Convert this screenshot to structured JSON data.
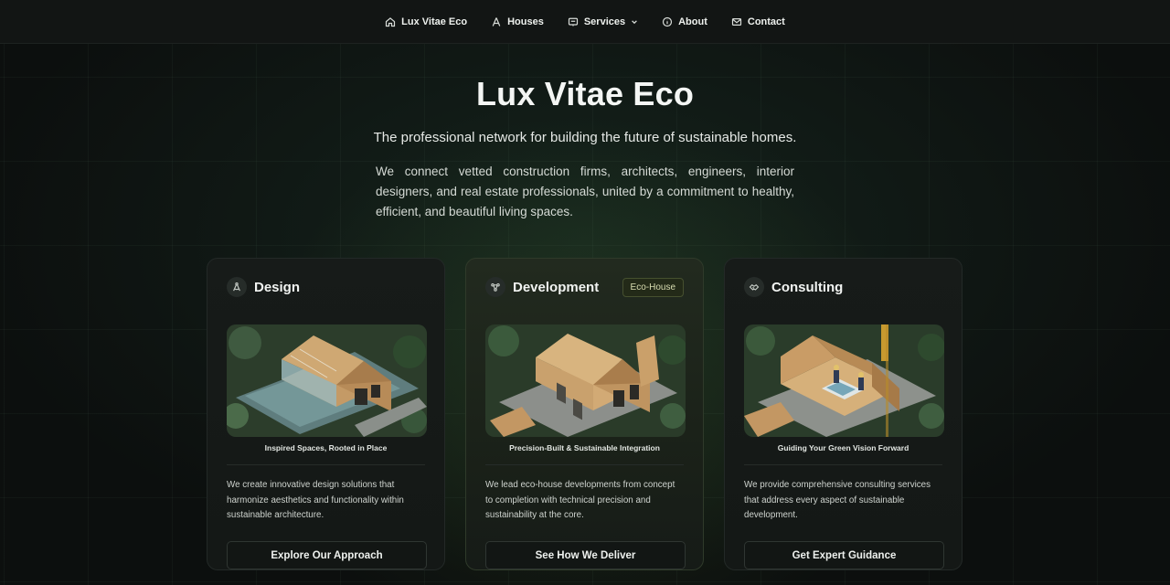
{
  "nav": {
    "items": [
      {
        "label": "Lux Vitae Eco",
        "icon": "home-icon"
      },
      {
        "label": "Houses",
        "icon": "houses-icon"
      },
      {
        "label": "Services",
        "icon": "services-icon",
        "has_dropdown": true
      },
      {
        "label": "About",
        "icon": "info-icon"
      },
      {
        "label": "Contact",
        "icon": "mail-icon"
      }
    ]
  },
  "hero": {
    "title": "Lux Vitae Eco",
    "tagline": "The professional network for building the future of sustainable homes.",
    "intro": "We connect vetted construction firms, architects, engineers, interior designers, and real estate professionals, united by a commitment to healthy, efficient, and beautiful living spaces."
  },
  "cards": [
    {
      "title": "Design",
      "icon": "compass-icon",
      "caption": "Inspired Spaces, Rooted in Place",
      "description": "We create innovative design solutions that harmonize aesthetics and functionality within sustainable architecture.",
      "cta": "Explore Our Approach"
    },
    {
      "title": "Development",
      "icon": "network-icon",
      "badge": "Eco-House",
      "caption": "Precision-Built & Sustainable Integration",
      "description": "We lead eco-house developments from concept to completion with technical precision and sustainability at the core.",
      "cta": "See How We Deliver"
    },
    {
      "title": "Consulting",
      "icon": "handshake-icon",
      "caption": "Guiding Your Green Vision Forward",
      "description": "We provide comprehensive consulting services that address every aspect of sustainable development.",
      "cta": "Get Expert Guidance"
    }
  ],
  "colors": {
    "background": "#0c0f0e",
    "accent_green": "#46502f",
    "card": "#171b19"
  }
}
